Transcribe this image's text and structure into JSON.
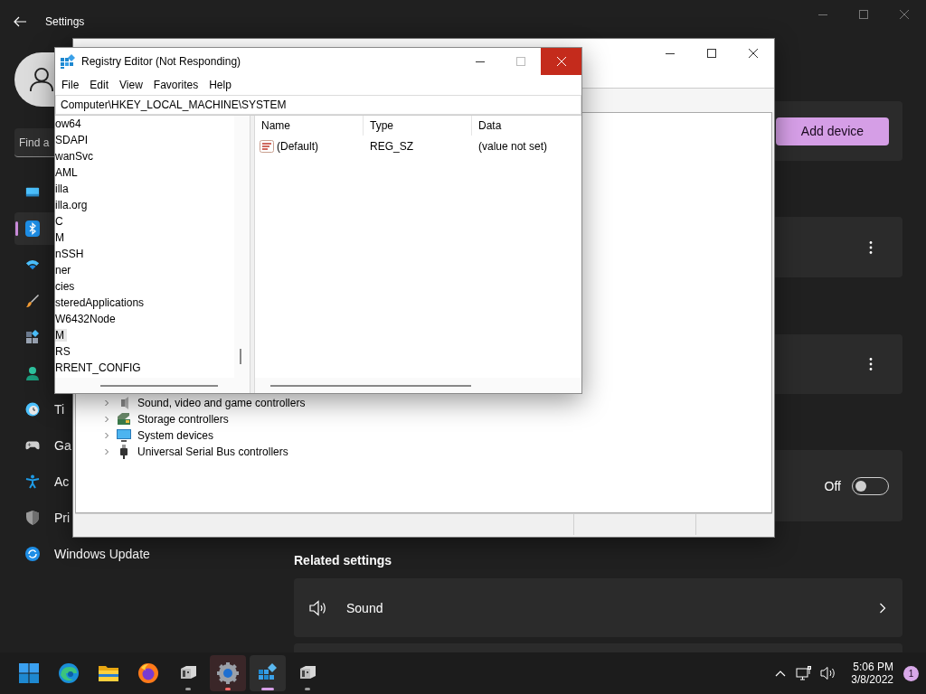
{
  "settings": {
    "title": "Settings",
    "search": {
      "placeholder": "Find a"
    },
    "nav": [
      {
        "selected": false
      },
      {
        "selected": true
      },
      {
        "selected": false
      },
      {
        "selected": false
      },
      {
        "selected": false
      },
      {
        "selected": false
      },
      {
        "label": "Ti",
        "selected": false
      },
      {
        "label": "Ga",
        "selected": false
      },
      {
        "label": "Ac",
        "selected": false
      },
      {
        "label": "Pri",
        "selected": false
      },
      {
        "label": "Windows Update",
        "selected": false
      }
    ],
    "cards": [
      {
        "kind": "button",
        "button": "Add device"
      },
      {
        "kind": "more"
      },
      {
        "kind": "more"
      },
      {
        "kind": "toggle",
        "state": "Off",
        "on": false
      }
    ],
    "related": {
      "title": "Related settings",
      "items": [
        {
          "label": "Sound"
        }
      ]
    }
  },
  "device_manager": {
    "tree": [
      {
        "label": "Sound, video and game controllers",
        "expanded": false
      },
      {
        "label": "Storage controllers",
        "expanded": false
      },
      {
        "label": "System devices",
        "expanded": false
      },
      {
        "label": "Universal Serial Bus controllers",
        "expanded": false
      }
    ]
  },
  "registry_editor": {
    "title": "Registry Editor (Not Responding)",
    "menu": [
      "File",
      "Edit",
      "View",
      "Favorites",
      "Help"
    ],
    "address": "Computer\\HKEY_LOCAL_MACHINE\\SYSTEM",
    "tree": [
      {
        "label": "ow64",
        "selected": false
      },
      {
        "label": "SDAPI",
        "selected": false
      },
      {
        "label": "wanSvc",
        "selected": false
      },
      {
        "label": "AML",
        "selected": false
      },
      {
        "label": "illa",
        "selected": false
      },
      {
        "label": "illa.org",
        "selected": false
      },
      {
        "label": "C",
        "selected": false
      },
      {
        "label": "M",
        "selected": false
      },
      {
        "label": "nSSH",
        "selected": false
      },
      {
        "label": "ner",
        "selected": false
      },
      {
        "label": "cies",
        "selected": false
      },
      {
        "label": "steredApplications",
        "selected": false
      },
      {
        "label": "W6432Node",
        "selected": false
      },
      {
        "label": "M",
        "selected": true
      },
      {
        "label": "RS",
        "selected": false
      },
      {
        "label": "RRENT_CONFIG",
        "selected": false
      }
    ],
    "columns": [
      "Name",
      "Type",
      "Data"
    ],
    "rows": [
      {
        "name": "(Default)",
        "type": "REG_SZ",
        "data": "(value not set)"
      }
    ]
  },
  "taskbar": {
    "apps": [
      {
        "kind": "idle"
      },
      {
        "kind": "idle"
      },
      {
        "kind": "idle"
      },
      {
        "kind": "idle"
      },
      {
        "kind": "running"
      },
      {
        "kind": "attention"
      },
      {
        "kind": "active"
      },
      {
        "kind": "running"
      }
    ],
    "clock": {
      "time": "5:06 PM",
      "date": "3/8/2022"
    },
    "badge": "1"
  }
}
